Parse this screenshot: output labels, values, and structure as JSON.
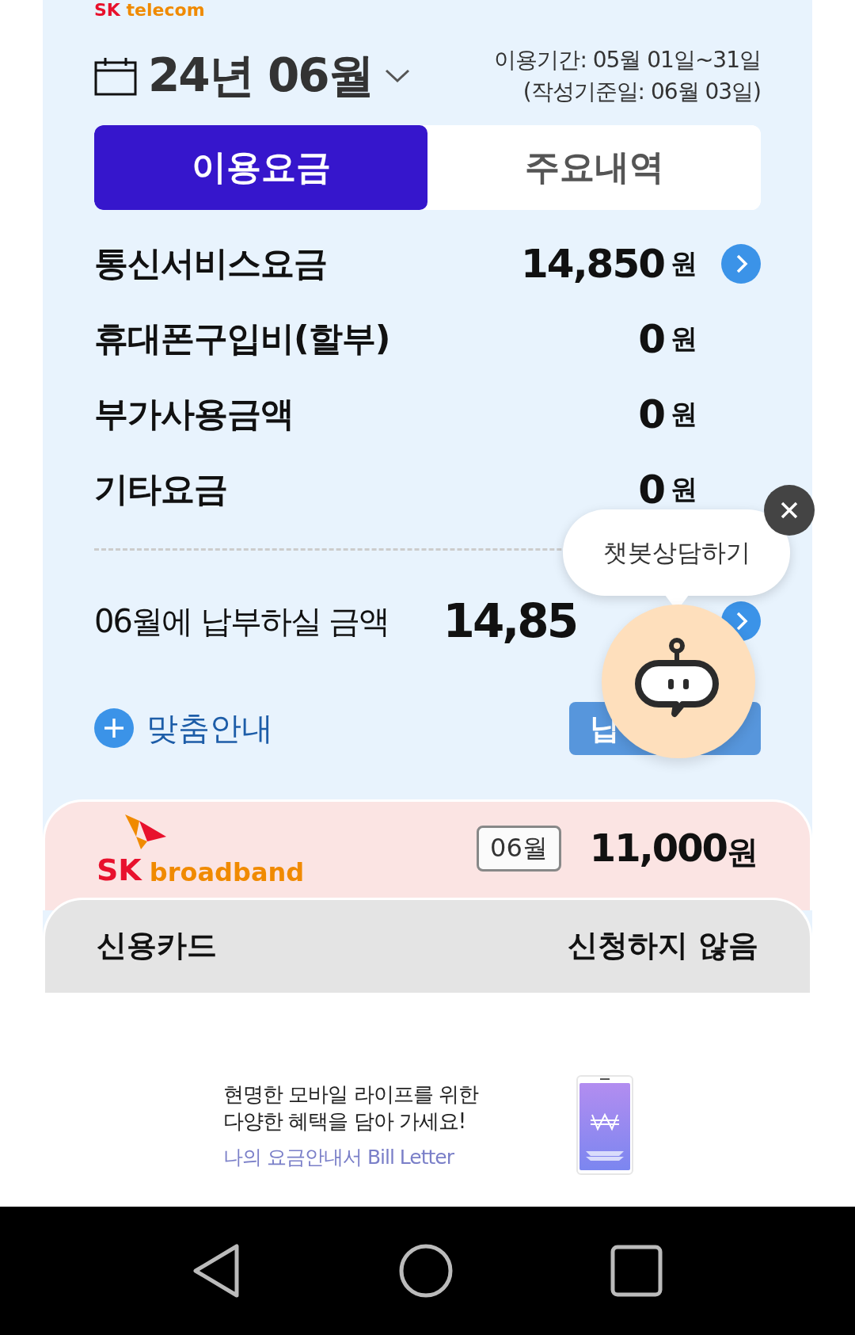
{
  "brand": {
    "logo_sk": "SK",
    "logo_name": "telecom"
  },
  "period": {
    "month": "24년 06월",
    "usage_period": "이용기간: 05월 01일~31일",
    "issue_date": "(작성기준일: 06월 03일)"
  },
  "tabs": [
    {
      "label": "이용요금",
      "selected": true
    },
    {
      "label": "주요내역",
      "selected": false
    }
  ],
  "charges": [
    {
      "label": "통신서비스요금",
      "amount": "14,850",
      "unit": "원",
      "has_detail": true
    },
    {
      "label": "휴대폰구입비(할부)",
      "amount": "0",
      "unit": "원",
      "has_detail": false
    },
    {
      "label": "부가사용금액",
      "amount": "0",
      "unit": "원",
      "has_detail": false
    },
    {
      "label": "기타요금",
      "amount": "0",
      "unit": "원",
      "has_detail": false
    }
  ],
  "total": {
    "label": "06월에 납부하실 금액",
    "amount": "14,85"
  },
  "guide_link": "맞춤안내",
  "pay_button": "납",
  "broadband": {
    "logo_sk": "SK",
    "logo_name": "broadband",
    "month": "06월",
    "amount": "11,000",
    "unit": "원"
  },
  "payment_method": {
    "label": "신용카드",
    "value": "신청하지 않음"
  },
  "banner": {
    "lines": [
      "현명한 모바일 라이프를 위한",
      "다양한 혜택을 담아 가세요!"
    ],
    "link": "나의 요금안내서 Bill Letter"
  },
  "chatbot": {
    "label": "챗봇상담하기"
  }
}
